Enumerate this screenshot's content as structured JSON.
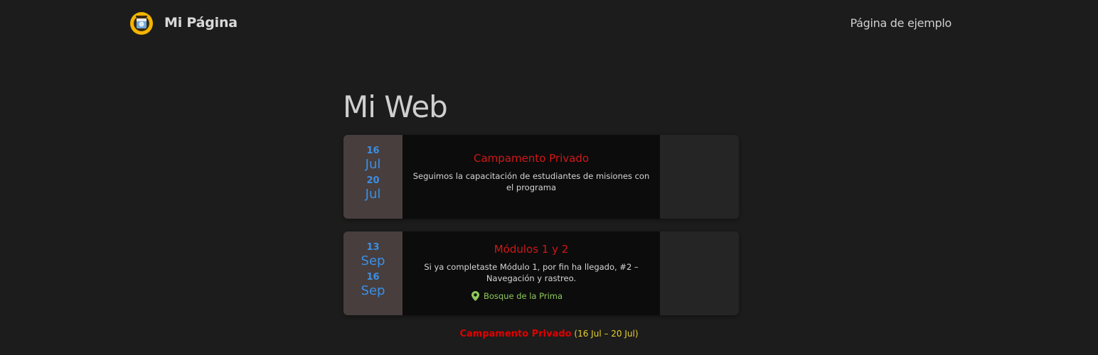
{
  "header": {
    "site_title": "Mi Página",
    "nav_link": "Página de ejemplo"
  },
  "page_title": "Mi Web",
  "events": [
    {
      "start_day": "16",
      "start_month": "Jul",
      "end_day": "20",
      "end_month": "Jul",
      "title": "Campamento Privado",
      "description": "Seguimos la capacitación de estudiantes de misiones con el programa"
    },
    {
      "start_day": "13",
      "start_month": "Sep",
      "end_day": "16",
      "end_month": "Sep",
      "title": "Módulos 1 y 2",
      "description": "Si ya completaste Módulo 1, por fin ha llegado, #2 – Navegación y rastreo.",
      "location": "Bosque de la Prima",
      "location_icon": "map-pin-icon"
    }
  ],
  "featured": {
    "title": "Campamento Privado",
    "dates": "(16 Jul – 20 Jul)"
  },
  "colors": {
    "background": "#1c1c1c",
    "date_accent": "#3b8fe6",
    "event_title": "#d01818",
    "location": "#8fc95a",
    "featured_dates": "#e6d22a"
  }
}
